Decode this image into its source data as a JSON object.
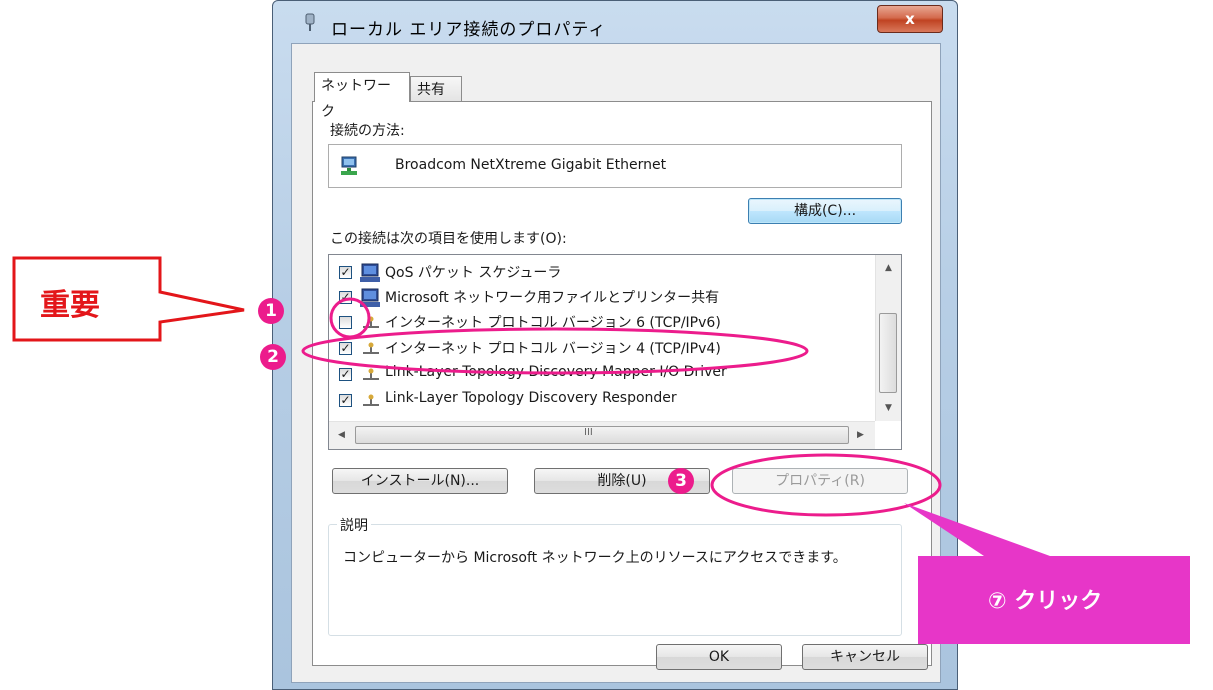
{
  "window": {
    "title": "ローカル エリア接続のプロパティ",
    "close_label": "x"
  },
  "tabs": [
    {
      "label": "ネットワーク",
      "selected": true
    },
    {
      "label": "共有",
      "selected": false
    }
  ],
  "connect_using": {
    "label": "接続の方法:",
    "adapter": "Broadcom NetXtreme Gigabit Ethernet",
    "configure_button": "構成(C)..."
  },
  "items_section": {
    "label": "この接続は次の項目を使用します(O):",
    "items": [
      {
        "label": "QoS パケット スケジューラ",
        "checked": true,
        "icon": "network-client-icon"
      },
      {
        "label": "Microsoft ネットワーク用ファイルとプリンター共有",
        "checked": true,
        "icon": "network-client-icon"
      },
      {
        "label": "インターネット プロトコル バージョン 6 (TCP/IPv6)",
        "checked": false,
        "icon": "protocol-icon"
      },
      {
        "label": "インターネット プロトコル バージョン 4 (TCP/IPv4)",
        "checked": true,
        "icon": "protocol-icon"
      },
      {
        "label": "Link-Layer Topology Discovery Mapper I/O Driver",
        "checked": true,
        "icon": "protocol-icon"
      },
      {
        "label": "Link-Layer Topology Discovery Responder",
        "checked": true,
        "icon": "protocol-icon"
      }
    ],
    "hscroll_center": "III"
  },
  "buttons": {
    "install": "インストール(N)...",
    "uninstall": "削除(U)",
    "properties": "プロパティ(R)"
  },
  "description": {
    "title": "説明",
    "text": "コンピューターから Microsoft ネットワーク上のリソースにアクセスできます。"
  },
  "dialog_buttons": {
    "ok": "OK",
    "cancel": "キャンセル"
  },
  "annotations": {
    "important": "重要",
    "num1": "1",
    "num2": "2",
    "num3": "3",
    "click": "⑦ クリック",
    "highlight_color": "#ec1c8c",
    "important_color": "#e3161a"
  }
}
